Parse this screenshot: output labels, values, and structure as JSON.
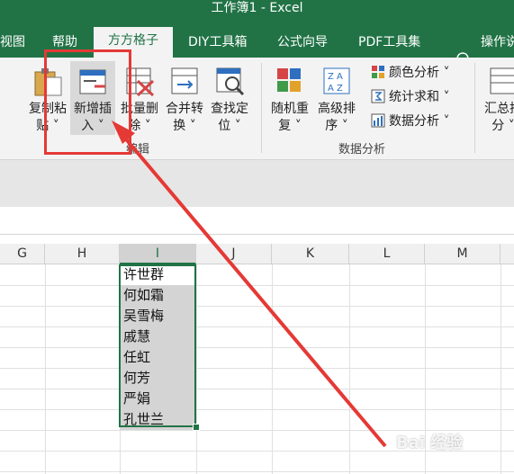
{
  "window": {
    "title": "工作簿1  -  Excel"
  },
  "tabs": [
    {
      "label": "视图"
    },
    {
      "label": "帮助"
    },
    {
      "label": "方方格子",
      "active": true
    },
    {
      "label": "DIY工具箱"
    },
    {
      "label": "公式向导"
    },
    {
      "label": "PDF工具集"
    },
    {
      "label": "操作说"
    }
  ],
  "ribbon": {
    "buttons": [
      {
        "line1": "复制粘",
        "line2": "贴 ˅",
        "icon": "clipboard-icon"
      },
      {
        "line1": "新增插",
        "line2": "入 ˅",
        "icon": "insert-row-icon"
      },
      {
        "line1": "批量删",
        "line2": "除 ˅",
        "icon": "batch-delete-icon"
      },
      {
        "line1": "合并转",
        "line2": "换 ˅",
        "icon": "merge-convert-icon"
      },
      {
        "line1": "查找定",
        "line2": "位 ˅",
        "icon": "find-locate-icon"
      },
      {
        "line1": "随机重",
        "line2": "复 ˅",
        "icon": "random-repeat-icon"
      },
      {
        "line1": "高级排",
        "line2": "序 ˅",
        "icon": "advanced-sort-icon"
      },
      {
        "line1": "汇总拆",
        "line2": "分 ˅",
        "icon": "summary-split-icon"
      }
    ],
    "small_buttons": [
      {
        "label": "颜色分析 ˅",
        "icon": "color-analysis-icon"
      },
      {
        "label": "统计求和 ˅",
        "icon": "stat-sum-icon"
      },
      {
        "label": "数据分析 ˅",
        "icon": "data-analysis-icon"
      }
    ],
    "groups": {
      "edit": "编辑",
      "data_analysis": "数据分析"
    }
  },
  "columns": [
    "G",
    "H",
    "I",
    "J",
    "K",
    "L",
    "M"
  ],
  "selected_column": "I",
  "cells": [
    "许世群",
    "何如霜",
    "吴雪梅",
    "戚慧",
    "任虹",
    "何芳",
    "严娟",
    "孔世兰"
  ],
  "watermark": "Bai 经验",
  "colors": {
    "excel_green": "#217346",
    "annotation_red": "#e53935"
  }
}
